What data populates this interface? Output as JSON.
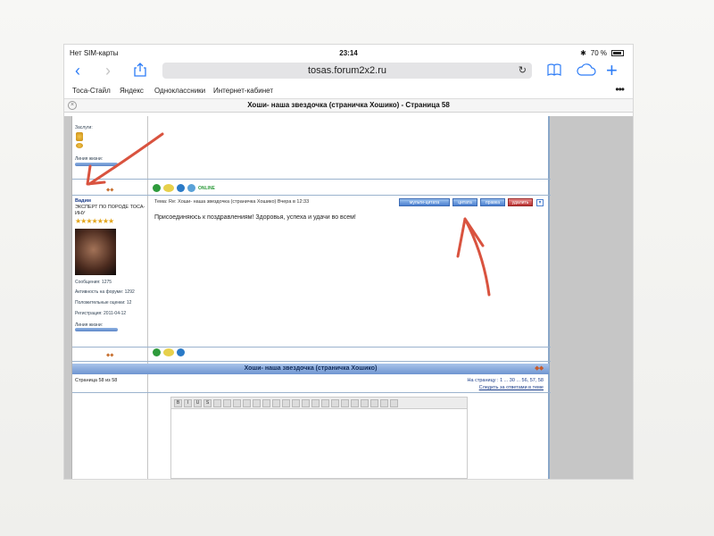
{
  "status_bar": {
    "carrier": "Нет SIM-карты",
    "time": "23:14",
    "battery": "70 %"
  },
  "browser": {
    "url": "tosas.forum2x2.ru",
    "bookmarks": [
      "Тоса-Стайл",
      "Яндекс",
      "Одноклассники",
      "Интернет-кабинет"
    ],
    "page_title": "Хоши- наша звездочка (страничка Хошико) - Страница 58"
  },
  "forum": {
    "top_profile": {
      "awards_label": "Заслуги:",
      "life_label": "Линия жизни:"
    },
    "post": {
      "author": "Вадим",
      "rank": "ЭКСПЕРТ ПО ПОРОДЕ ТОСА-ИНУ",
      "stars": "★★★★★★★",
      "messages": "Сообщения: 1275",
      "activity": "Активность на форуме: 1292",
      "reputation": "Положительные оценки: 12",
      "registered": "Регистрация: 2011-04-12",
      "life_label": "Линия жизни:",
      "header": "Тема: Re: Хоши- наша звездочка (страничка Хошико)   Вчера в 12:33",
      "text": "Присоединяюсь к поздравлениям! Здоровья, успеха и удачи во всем!",
      "buttons": [
        "мульти-цитата",
        "цитата",
        "правка",
        "удалить"
      ],
      "online": "ONLINE"
    },
    "topic_banner": "Хоши- наша звездочка (страничка Хошико)",
    "page_info": "Страница 58 из 58",
    "pagination": "На страницу : 1 ... 30 ... 56, 57, 58",
    "watch": "Следить за ответами в теме"
  },
  "colors": {
    "accent": "#2d7cf6",
    "arrow": "#d9533f"
  }
}
